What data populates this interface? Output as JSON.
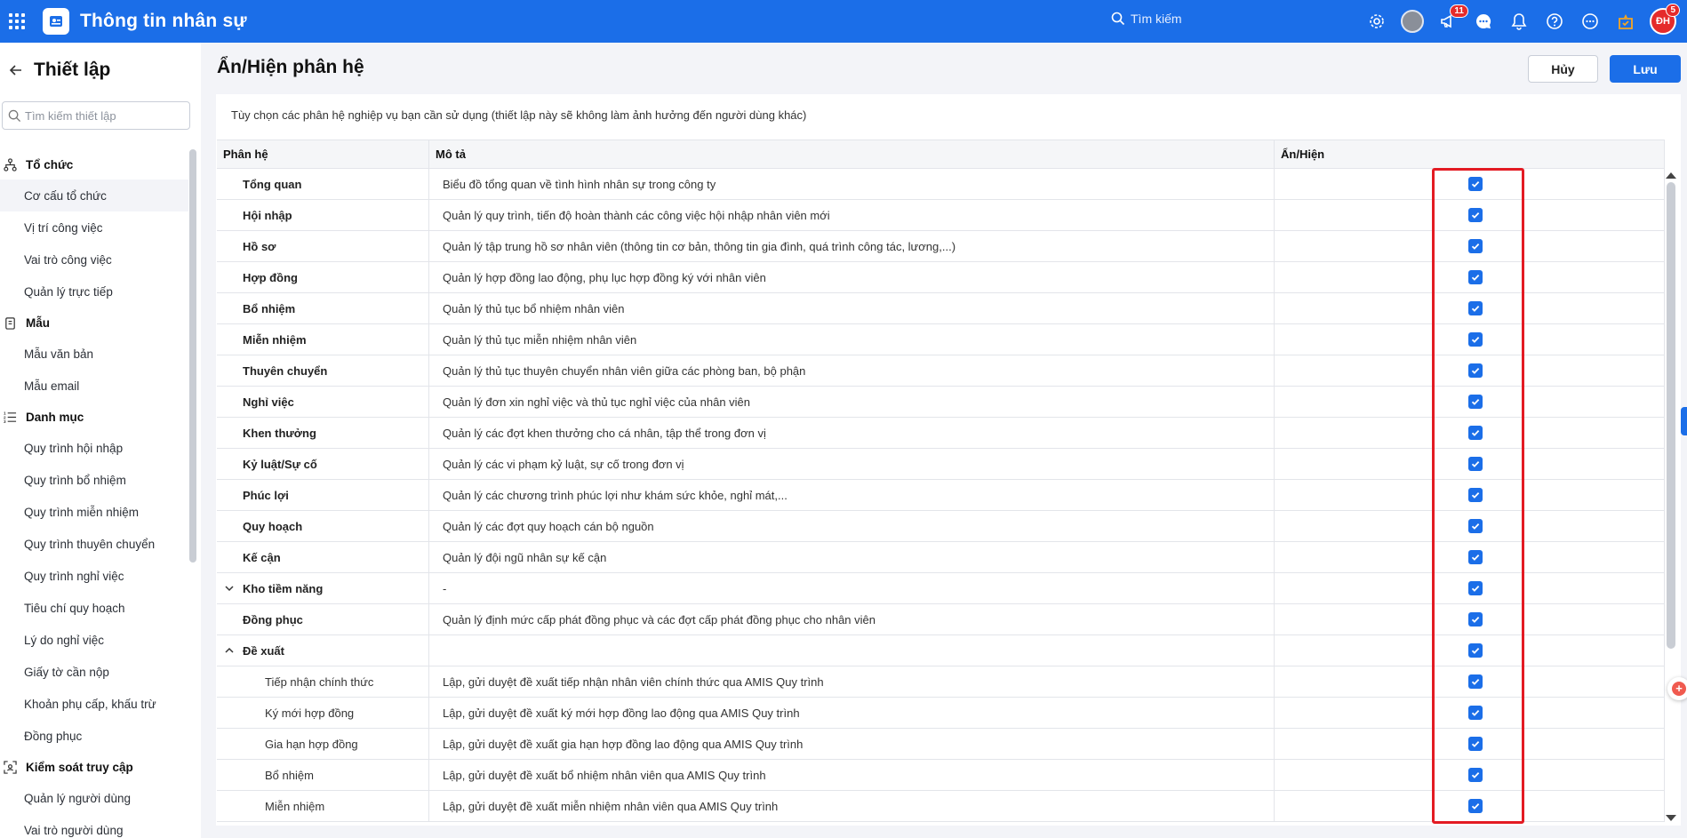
{
  "header": {
    "app_title": "Thông tin nhân sự",
    "search_placeholder": "Tìm kiếm",
    "notification_badge": "11",
    "user_initials": "ĐH",
    "user_badge": "5",
    "brand_color": "#1b6ee8"
  },
  "sidebar": {
    "title": "Thiết lập",
    "search_placeholder": "Tìm kiếm thiết lập",
    "groups": [
      {
        "label": "Tổ chức",
        "icon": "org-chart-icon",
        "items": [
          "Cơ cấu tổ chức",
          "Vị trí công việc",
          "Vai trò công việc",
          "Quản lý trực tiếp"
        ]
      },
      {
        "label": "Mẫu",
        "icon": "clipboard-icon",
        "items": [
          "Mẫu văn bản",
          "Mẫu email"
        ]
      },
      {
        "label": "Danh mục",
        "icon": "list-icon",
        "items": [
          "Quy trình hội nhập",
          "Quy trình bổ nhiệm",
          "Quy trình miễn nhiệm",
          "Quy trình thuyên chuyển",
          "Quy trình nghỉ việc",
          "Tiêu chí quy hoạch",
          "Lý do nghỉ việc",
          "Giấy tờ cần nộp",
          "Khoản phụ cấp, khấu trừ",
          "Đồng phục"
        ]
      },
      {
        "label": "Kiểm soát truy cập",
        "icon": "access-control-icon",
        "items": [
          "Quản lý người dùng",
          "Vai trò người dùng"
        ]
      }
    ]
  },
  "main": {
    "title": "Ẩn/Hiện phân hệ",
    "cancel_label": "Hủy",
    "save_label": "Lưu",
    "note": "Tùy chọn các phân hệ nghiệp vụ bạn cần sử dụng (thiết lập này sẽ không làm ảnh hưởng đến người dùng khác)",
    "columns": [
      "Phân hệ",
      "Mô tả",
      "Ẩn/Hiện"
    ],
    "rows": [
      {
        "name": "Tổng quan",
        "desc": "Biểu đồ tổng quan về tình hình nhân sự trong công ty",
        "checked": true
      },
      {
        "name": "Hội nhập",
        "desc": "Quản lý quy trình, tiến độ hoàn thành các công việc hội nhập nhân viên mới",
        "checked": true
      },
      {
        "name": "Hồ sơ",
        "desc": "Quản lý tập trung hồ sơ nhân viên (thông tin cơ bản, thông tin gia đình, quá trình công tác, lương,...)",
        "checked": true
      },
      {
        "name": "Hợp đồng",
        "desc": "Quản lý hợp đồng lao động, phụ lục hợp đồng ký với nhân viên",
        "checked": true
      },
      {
        "name": "Bổ nhiệm",
        "desc": "Quản lý thủ tục bổ nhiệm nhân viên",
        "checked": true
      },
      {
        "name": "Miễn nhiệm",
        "desc": "Quản lý thủ tục miễn nhiệm nhân viên",
        "checked": true
      },
      {
        "name": "Thuyên chuyển",
        "desc": "Quản lý thủ tục thuyên chuyển nhân viên giữa các phòng ban, bộ phận",
        "checked": true
      },
      {
        "name": "Nghỉ việc",
        "desc": "Quản lý đơn xin nghỉ việc và thủ tục nghỉ việc của nhân viên",
        "checked": true
      },
      {
        "name": "Khen thưởng",
        "desc": "Quản lý các đợt khen thưởng cho cá nhân, tập thể trong đơn vị",
        "checked": true
      },
      {
        "name": "Kỷ luật/Sự cố",
        "desc": "Quản lý các vi phạm kỷ luật, sự cố trong đơn vị",
        "checked": true
      },
      {
        "name": "Phúc lợi",
        "desc": "Quản lý các chương trình phúc lợi như khám sức khỏe, nghỉ mát,...",
        "checked": true
      },
      {
        "name": "Quy hoạch",
        "desc": "Quản lý các đợt quy hoạch cán bộ nguồn",
        "checked": true
      },
      {
        "name": "Kế cận",
        "desc": "Quản lý đội ngũ nhân sự kế cận",
        "checked": true
      },
      {
        "name": "Kho tiềm năng",
        "desc": "-",
        "checked": true,
        "toggle": "down"
      },
      {
        "name": "Đồng phục",
        "desc": "Quản lý định mức cấp phát đồng phục và các đợt cấp phát đồng phục cho nhân viên",
        "checked": true
      },
      {
        "name": "Đề xuất",
        "desc": "",
        "checked": true,
        "toggle": "up"
      },
      {
        "name": "Tiếp nhận chính thức",
        "desc": "Lập, gửi duyệt đề xuất tiếp nhận nhân viên chính thức qua AMIS Quy trình",
        "checked": true,
        "child": true
      },
      {
        "name": "Ký mới hợp đồng",
        "desc": "Lập, gửi duyệt đề xuất ký mới hợp đồng lao động qua AMIS Quy trình",
        "checked": true,
        "child": true
      },
      {
        "name": "Gia hạn hợp đồng",
        "desc": "Lập, gửi duyệt đề xuất gia hạn hợp đồng lao động qua AMIS Quy trình",
        "checked": true,
        "child": true
      },
      {
        "name": "Bổ nhiệm",
        "desc": "Lập, gửi duyệt đề xuất bổ nhiệm nhân viên qua AMIS Quy trình",
        "checked": true,
        "child": true
      },
      {
        "name": "Miễn nhiệm",
        "desc": "Lập, gửi duyệt đề xuất miễn nhiệm nhân viên qua AMIS Quy trình",
        "checked": true,
        "child": true
      }
    ]
  }
}
